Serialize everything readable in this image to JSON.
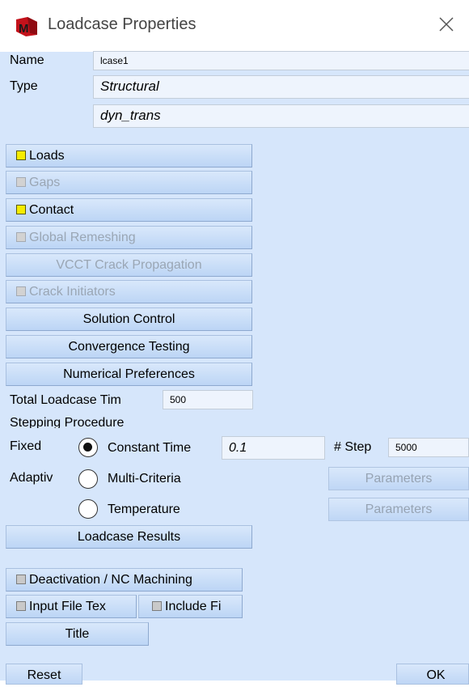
{
  "window": {
    "title": "Loadcase Properties",
    "app_icon": "marc-logo-icon",
    "close_icon": "close-icon"
  },
  "name": {
    "label": "Name",
    "value": "lcase1"
  },
  "type": {
    "label": "Type",
    "value1": "Structural",
    "value2": "dyn_trans"
  },
  "buttons": {
    "loads": "Loads",
    "gaps": "Gaps",
    "contact": "Contact",
    "global_remeshing": "Global Remeshing",
    "vcct": "VCCT Crack Propagation",
    "crack_initiators": "Crack Initiators",
    "solution_control": "Solution Control",
    "convergence_testing": "Convergence Testing",
    "numerical_preferences": "Numerical Preferences",
    "loadcase_results": "Loadcase Results",
    "deactivation": "Deactivation / NC Machining",
    "input_file_text": "Input File Tex",
    "include_file": "Include Fi",
    "title": "Title",
    "reset": "Reset",
    "ok": "OK"
  },
  "total_time": {
    "label": "Total Loadcase Tim",
    "value": "500"
  },
  "stepping": {
    "label": "Stepping Procedure",
    "fixed_label": "Fixed",
    "adaptive_label": "Adaptiv",
    "constant_time": "Constant Time",
    "constant_time_value": "0.1",
    "steps_label": "# Step",
    "steps_value": "5000",
    "multi_criteria": "Multi-Criteria",
    "temperature": "Temperature",
    "parameters1": "Parameters",
    "parameters2": "Parameters",
    "selected": "Constant Time"
  },
  "colors": {
    "panel_bg": "#d6e6fb",
    "checked_yellow": "#f6ec00",
    "disabled_text": "#9aa6b4"
  }
}
